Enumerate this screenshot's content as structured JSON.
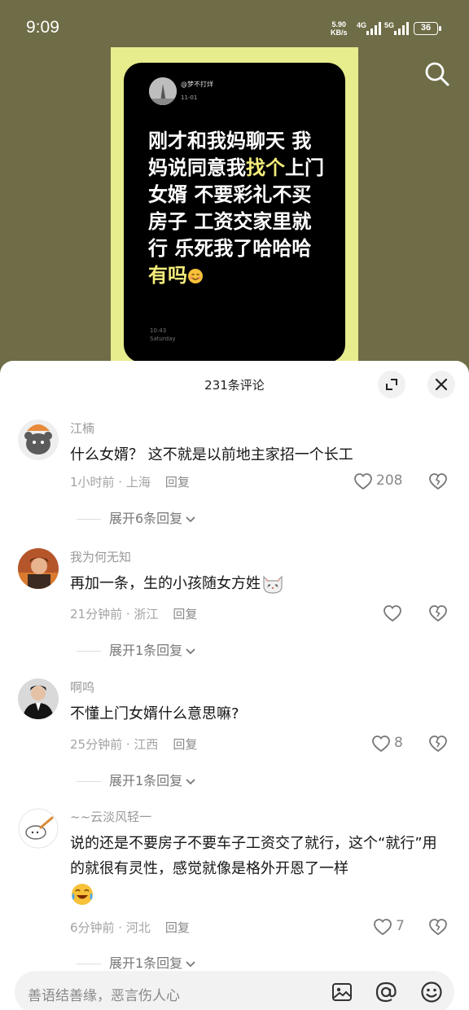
{
  "status_bar": {
    "time": "9:09",
    "speed_value": "5.90",
    "speed_unit": "KB/s",
    "network_1": "4G",
    "network_2": "5G",
    "battery": "36"
  },
  "post": {
    "username": "@梦不打烊",
    "date": "11-01",
    "text_part1": "刚才和我妈聊天 我妈说同意我",
    "text_highlight1": "找个",
    "text_part2": "上门女婿 不要彩礼不买房子 工资交家里就行 乐死我了哈哈哈 ",
    "text_highlight2": "有吗",
    "time": "10:43",
    "day": "Saturday"
  },
  "comments_header": {
    "title": "231条评论"
  },
  "comments": [
    {
      "name": "江楠",
      "text": "什么女婿？ 这不就是以前地主家招一个长工",
      "time": "1小时前 · 上海",
      "reply": "回复",
      "likes": "208",
      "expand": "展开6条回复"
    },
    {
      "name": "我为何无知",
      "text": "再加一条，生的小孩随女方姓",
      "time": "21分钟前 · 浙江",
      "reply": "回复",
      "likes": "",
      "expand": "展开1条回复"
    },
    {
      "name": "啊呜",
      "text": "不懂上门女婿什么意思嘛?",
      "time": "25分钟前 · 江西",
      "reply": "回复",
      "likes": "8",
      "expand": "展开1条回复"
    },
    {
      "name": "~~云淡风轻一",
      "text": "说的还是不要房子不要车子工资交了就行，这个“就行”用的就很有灵性，感觉就像是格外开恩了一样",
      "time": "6分钟前 · 河北",
      "reply": "回复",
      "likes": "7",
      "expand": "展开1条回复"
    }
  ],
  "input": {
    "placeholder": "善语结善缘，恶言伤人心"
  },
  "icons": {
    "search": "search-icon",
    "expand_sheet": "expand-icon",
    "close": "close-icon",
    "like": "heart-icon",
    "dislike": "broken-heart-icon",
    "image": "image-icon",
    "mention": "at-icon",
    "emoji": "emoji-icon"
  }
}
